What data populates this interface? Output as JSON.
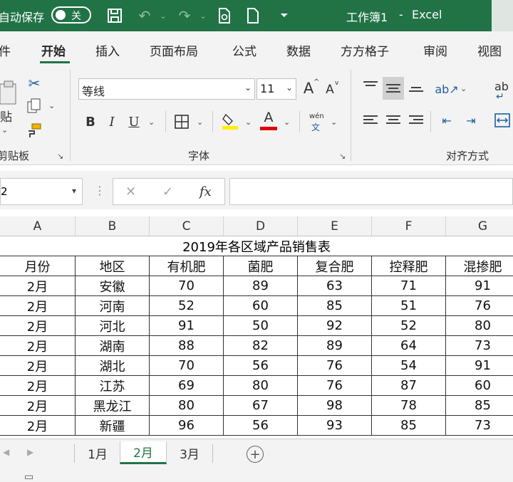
{
  "titlebar": {
    "autosave_label": "自动保存",
    "autosave_state": "关",
    "workbook": "工作簿1",
    "separator": "-",
    "app": "Excel"
  },
  "tabs": [
    "件",
    "开始",
    "插入",
    "页面布局",
    "公式",
    "数据",
    "方方格子",
    "审阅",
    "视图"
  ],
  "ribbon": {
    "clipboard": {
      "paste": "贴",
      "label": "剪贴板"
    },
    "font": {
      "name": "等线",
      "size": "11",
      "grow": "A",
      "shrink": "A",
      "bold": "B",
      "italic": "I",
      "underline": "U",
      "font_color": "A",
      "wen": "wén",
      "wen_char": "文",
      "label": "字体"
    },
    "align": {
      "label": "对齐方式",
      "wrap": "ab"
    }
  },
  "formula_bar": {
    "name_box": "2",
    "fx": "fx",
    "cancel": "✕",
    "enter": "✓",
    "formula": ""
  },
  "colors": {
    "brand": "#217346"
  },
  "sheet": {
    "columns": [
      "A",
      "B",
      "C",
      "D",
      "E",
      "F",
      "G"
    ],
    "title": "2019年各区域产品销售表",
    "headers": [
      "月份",
      "地区",
      "有机肥",
      "菌肥",
      "复合肥",
      "控释肥",
      "混掺肥"
    ],
    "rows": [
      [
        "2月",
        "安徽",
        "70",
        "89",
        "63",
        "71",
        "91"
      ],
      [
        "2月",
        "河南",
        "52",
        "60",
        "85",
        "51",
        "76"
      ],
      [
        "2月",
        "河北",
        "91",
        "50",
        "92",
        "52",
        "80"
      ],
      [
        "2月",
        "湖南",
        "88",
        "82",
        "89",
        "64",
        "73"
      ],
      [
        "2月",
        "湖北",
        "70",
        "56",
        "76",
        "54",
        "91"
      ],
      [
        "2月",
        "江苏",
        "69",
        "80",
        "76",
        "87",
        "60"
      ],
      [
        "2月",
        "黑龙江",
        "80",
        "67",
        "98",
        "78",
        "85"
      ],
      [
        "2月",
        "新疆",
        "96",
        "56",
        "93",
        "85",
        "73"
      ]
    ]
  },
  "sheet_tabs": {
    "tabs": [
      "1月",
      "2月",
      "3月"
    ],
    "active": "2月",
    "add": "+"
  }
}
